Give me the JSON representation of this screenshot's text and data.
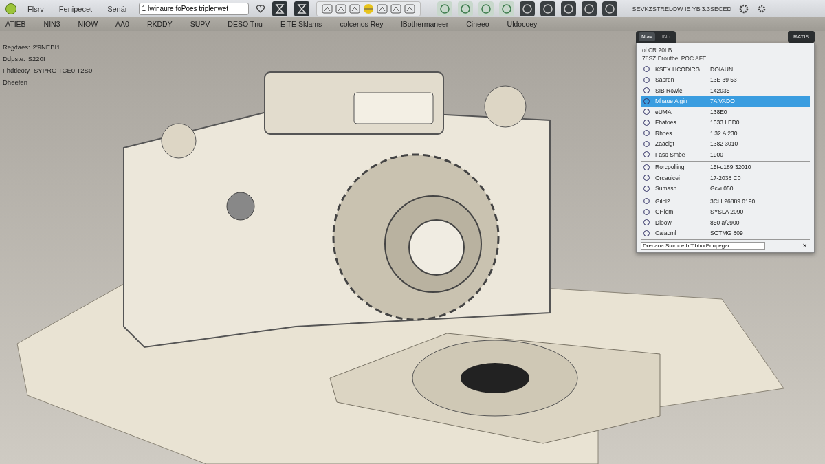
{
  "toolbar": {
    "menus": [
      "Flsrv",
      "Fenipecet",
      "Senär"
    ],
    "search": {
      "value": "1 Iwinaure foPoes triplenwet"
    },
    "status": "SEVKZSTRELOW IE YB'3.3SECED"
  },
  "menu_bar": [
    "ATIEB",
    "NIN3",
    "NIOW",
    "AA0",
    "RKDDY",
    "SUPV",
    "DESO Tnu",
    "E TE Sklams",
    "colcenos Rey",
    "lBothermaneer",
    "Cineeo",
    "Uldocoey"
  ],
  "viewport": {
    "info": [
      {
        "label": "Rejytaes:",
        "value": "2'9NEBI1"
      },
      {
        "label": "Ddpste:",
        "value": "S220I"
      },
      {
        "label": "Fhdtleoty.",
        "value": "SYPRG TCE0 T2S0"
      },
      {
        "label": "Dheefen"
      }
    ]
  },
  "panel": {
    "tabs": [
      {
        "label": "Nlav",
        "selected": true
      },
      {
        "label": "lNo",
        "selected": false
      }
    ],
    "corner_button": "RATIS",
    "header": [
      "ol CR 20LB",
      "78SZ Eroutbel POC AFE"
    ],
    "sections": [
      {
        "rows": [
          {
            "name": "KSEX HCODIRG",
            "value": "DOIAUN",
            "selected": false
          },
          {
            "name": "Säoren",
            "value": "13E 39 53",
            "selected": false
          },
          {
            "name": "SIB Rowle",
            "value": "142035",
            "selected": false
          },
          {
            "name": "Mhaue Algin",
            "value": "7A VADO",
            "selected": true
          },
          {
            "name": "eUMA",
            "value": "138E0",
            "selected": false
          },
          {
            "name": "Fhatoes",
            "value": "1033 LED0",
            "selected": false
          },
          {
            "name": "Rhoes",
            "value": "1'32 A 230",
            "selected": false
          },
          {
            "name": "Zaacigt",
            "value": "1382 3010",
            "selected": false
          },
          {
            "name": "Faso Smbe",
            "value": "1900",
            "selected": false
          }
        ]
      },
      {
        "rows": [
          {
            "name": "Rorcpolling",
            "value": "15t-d189 32010",
            "selected": false
          },
          {
            "name": "Orcauicei",
            "value": "17-2038 C0",
            "selected": false
          },
          {
            "name": "Sumasn",
            "value": "Gcvi 050",
            "selected": false
          }
        ]
      },
      {
        "rows": [
          {
            "name": "Gilol2",
            "value": "3CLL26889.0190",
            "selected": false
          },
          {
            "name": "GHiem",
            "value": "SYSLA 2090",
            "selected": false
          },
          {
            "name": "Dioow",
            "value": "850 a/2900",
            "selected": false
          },
          {
            "name": "Caiacml",
            "value": "SOTMG 809",
            "selected": false
          }
        ]
      }
    ],
    "footer_field": {
      "value": "Drenana Stornce b T'bborEnupegar"
    },
    "close": "×"
  }
}
